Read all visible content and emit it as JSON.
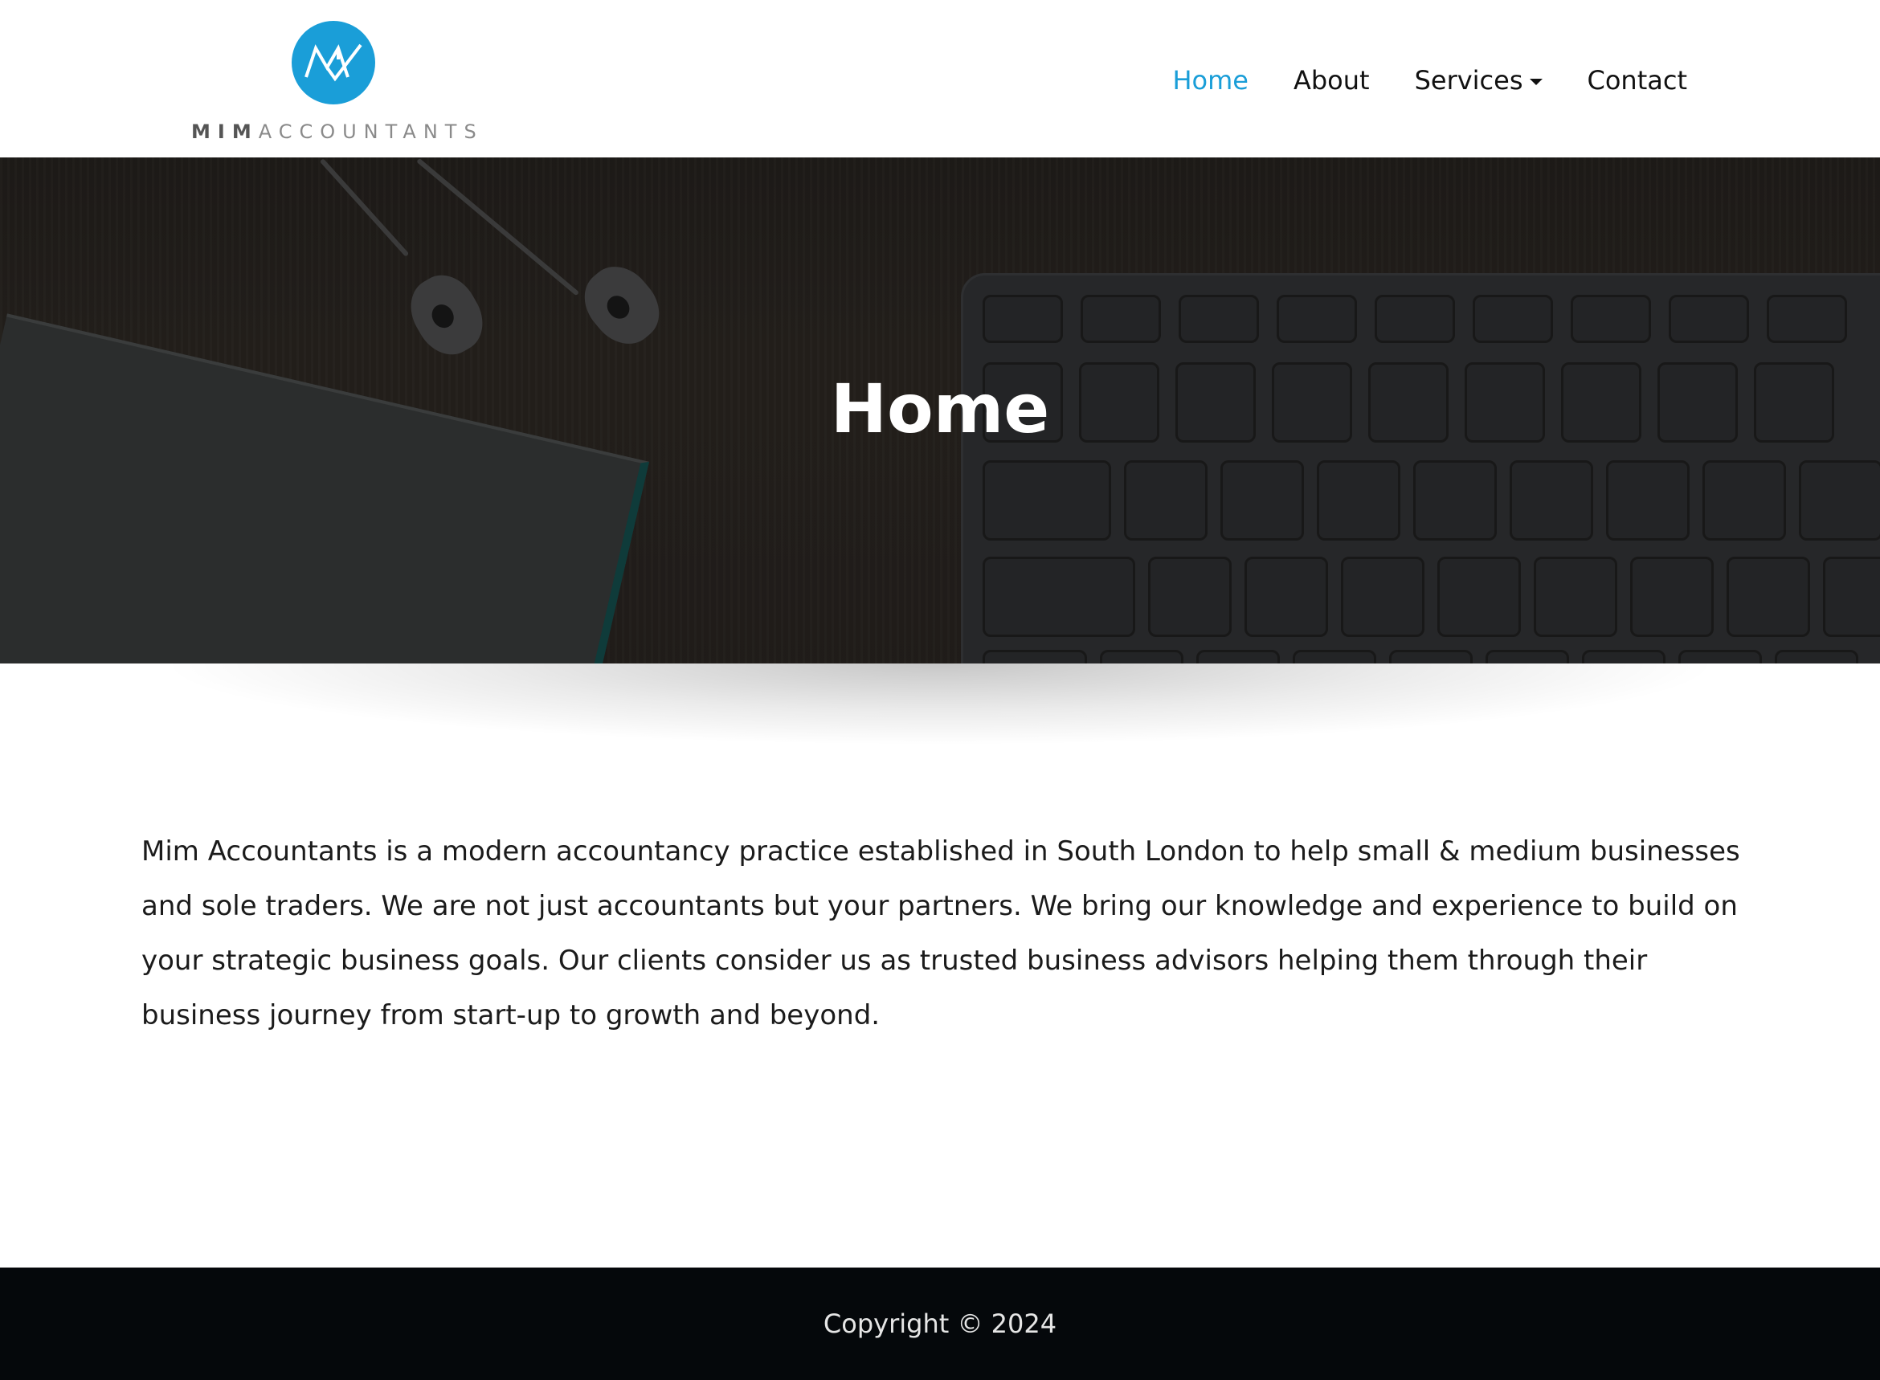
{
  "brand": {
    "name_bold": "MIM",
    "name_light": "ACCOUNTANTS",
    "accent_color": "#1a9ed8",
    "logo_icon": "mim-monogram-icon"
  },
  "nav": {
    "items": [
      {
        "label": "Home",
        "active": true
      },
      {
        "label": "About",
        "active": false
      },
      {
        "label": "Services",
        "active": false,
        "dropdown": true
      },
      {
        "label": "Contact",
        "active": false
      }
    ]
  },
  "hero": {
    "title": "Home"
  },
  "main": {
    "intro": "Mim Accountants is a modern accountancy practice established in South London to help small & medium businesses and sole traders. We are not just accountants but your partners. We bring our knowledge and experience to build on your strategic business goals. Our clients consider us as trusted business advisors helping them through their business journey from start-up to growth and beyond."
  },
  "footer": {
    "copyright": "Copyright © 2024"
  }
}
